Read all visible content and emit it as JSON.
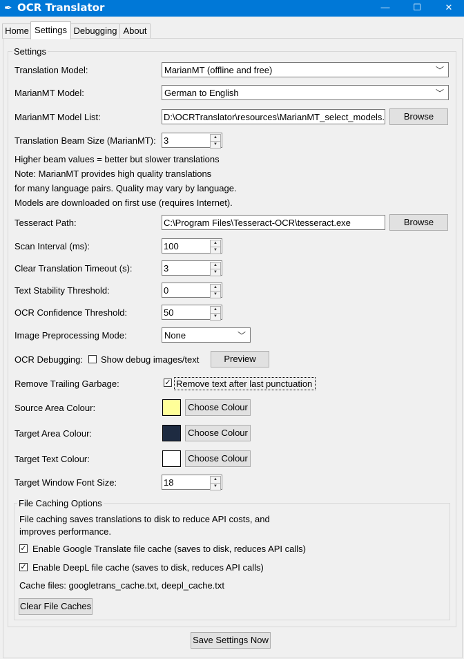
{
  "window": {
    "title": "OCR Translator",
    "app_icon": "feather-icon",
    "controls": {
      "minimize": "—",
      "maximize": "☐",
      "close": "✕"
    }
  },
  "tabs": [
    {
      "label": "Home",
      "active": false
    },
    {
      "label": "Settings",
      "active": true
    },
    {
      "label": "Debugging",
      "active": false
    },
    {
      "label": "About",
      "active": false
    }
  ],
  "settings": {
    "group_label": "Settings",
    "translation_model": {
      "label": "Translation Model:",
      "value": "MarianMT (offline and free)"
    },
    "marian_model": {
      "label": "MarianMT Model:",
      "value": "German to English"
    },
    "marian_model_list": {
      "label": "MarianMT Model List:",
      "value": "D:\\OCRTranslator\\resources\\MarianMT_select_models.csv",
      "button": "Browse"
    },
    "beam_size": {
      "label": "Translation Beam Size (MarianMT):",
      "value": "3"
    },
    "notes": [
      "Higher beam values = better but slower translations",
      "Note: MarianMT provides high quality translations",
      "for many language pairs. Quality may vary by language.",
      "Models are downloaded on first use (requires Internet)."
    ],
    "tesseract_path": {
      "label": "Tesseract Path:",
      "value": "C:\\Program Files\\Tesseract-OCR\\tesseract.exe",
      "button": "Browse"
    },
    "scan_interval": {
      "label": "Scan Interval (ms):",
      "value": "100"
    },
    "clear_timeout": {
      "label": "Clear Translation Timeout (s):",
      "value": "3"
    },
    "stability": {
      "label": "Text Stability Threshold:",
      "value": "0"
    },
    "ocr_confidence": {
      "label": "OCR Confidence Threshold:",
      "value": "50"
    },
    "preprocessing": {
      "label": "Image Preprocessing Mode:",
      "value": "None"
    },
    "ocr_debugging": {
      "label": "OCR Debugging:",
      "checkbox_label": "Show debug images/text",
      "checked": false,
      "button": "Preview"
    },
    "trailing_garbage": {
      "label": "Remove Trailing Garbage:",
      "checkbox_label": "Remove text after last punctuation",
      "checked": true
    },
    "source_colour": {
      "label": "Source Area Colour:",
      "color": "#ffff99",
      "button": "Choose Colour"
    },
    "target_colour": {
      "label": "Target Area Colour:",
      "color": "#1e2b41",
      "button": "Choose Colour"
    },
    "target_text_colour": {
      "label": "Target Text Colour:",
      "color": "#ffffff",
      "button": "Choose Colour"
    },
    "font_size": {
      "label": "Target Window Font Size:",
      "value": "18"
    }
  },
  "file_caching": {
    "group_label": "File Caching Options",
    "description_line1": "File caching saves translations to disk to reduce API costs, and",
    "description_line2": "improves performance.",
    "google_cache": {
      "label": "Enable Google Translate file cache (saves to disk, reduces API calls)",
      "checked": true
    },
    "deepl_cache": {
      "label": "Enable DeepL file cache (saves to disk, reduces API calls)",
      "checked": true
    },
    "cache_files": "Cache files: googletrans_cache.txt, deepl_cache.txt",
    "clear_button": "Clear File Caches"
  },
  "save_button": "Save Settings Now",
  "colors": {
    "titlebar": "#0078d7",
    "window_bg": "#f0f0f0"
  }
}
